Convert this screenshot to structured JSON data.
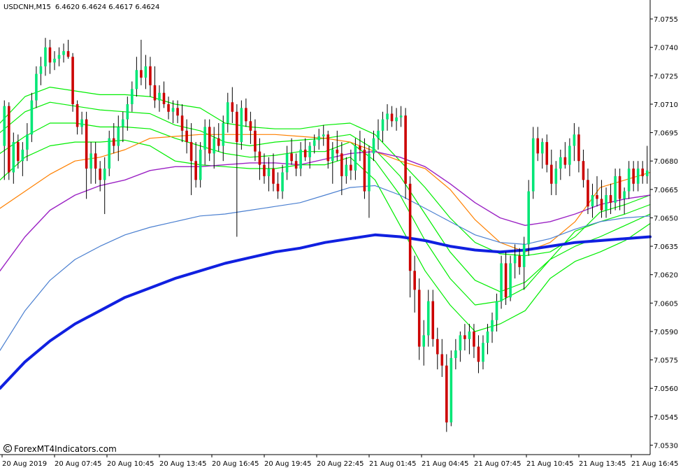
{
  "header": {
    "symbol_label": "USDCNH,M15",
    "ohlc_text": "6.4620 6.4624 6.4617 6.4624"
  },
  "watermark": {
    "text": "ForexMT4Indicators.com"
  },
  "chart_data": {
    "type": "candlestick",
    "y_axis_ticks": [
      "7.0755",
      "7.0740",
      "7.0725",
      "7.0710",
      "7.0695",
      "7.0680",
      "7.0665",
      "7.0650",
      "7.0635",
      "7.0620",
      "7.0605",
      "7.0590",
      "7.0575",
      "7.0560",
      "7.0545",
      "7.0530"
    ],
    "y_range": [
      7.0525,
      7.0765
    ],
    "x_axis_ticks": [
      "20 Aug 2019",
      "20 Aug 07:45",
      "20 Aug 10:45",
      "20 Aug 13:45",
      "20 Aug 16:45",
      "20 Aug 19:45",
      "20 Aug 22:45",
      "21 Aug 01:45",
      "21 Aug 04:45",
      "21 Aug 07:45",
      "21 Aug 10:45",
      "21 Aug 13:45",
      "21 Aug 16:45"
    ],
    "colors": {
      "background": "#ffffff",
      "axis": "#000000",
      "bull_candle": "#00e676",
      "bear_candle": "#cc0000",
      "wick": "#000000"
    },
    "candles": [
      {
        "o": 7.0688,
        "h": 7.0712,
        "l": 7.067,
        "c": 7.0709
      },
      {
        "o": 7.0709,
        "h": 7.0711,
        "l": 7.067,
        "c": 7.0674
      },
      {
        "o": 7.0674,
        "h": 7.0695,
        "l": 7.0668,
        "c": 7.069
      },
      {
        "o": 7.069,
        "h": 7.0694,
        "l": 7.0676,
        "c": 7.068
      },
      {
        "o": 7.068,
        "h": 7.069,
        "l": 7.0672,
        "c": 7.0686
      },
      {
        "o": 7.0686,
        "h": 7.07,
        "l": 7.068,
        "c": 7.0694
      },
      {
        "o": 7.0694,
        "h": 7.0716,
        "l": 7.069,
        "c": 7.0712
      },
      {
        "o": 7.0712,
        "h": 7.073,
        "l": 7.0708,
        "c": 7.0726
      },
      {
        "o": 7.0726,
        "h": 7.0735,
        "l": 7.072,
        "c": 7.073
      },
      {
        "o": 7.073,
        "h": 7.0745,
        "l": 7.0725,
        "c": 7.074
      },
      {
        "o": 7.074,
        "h": 7.0744,
        "l": 7.0726,
        "c": 7.0732
      },
      {
        "o": 7.0732,
        "h": 7.0738,
        "l": 7.0728,
        "c": 7.0734
      },
      {
        "o": 7.0734,
        "h": 7.074,
        "l": 7.073,
        "c": 7.0736
      },
      {
        "o": 7.0736,
        "h": 7.0742,
        "l": 7.0732,
        "c": 7.0738
      },
      {
        "o": 7.0738,
        "h": 7.0744,
        "l": 7.0734,
        "c": 7.0735
      },
      {
        "o": 7.0735,
        "h": 7.0737,
        "l": 7.0706,
        "c": 7.071
      },
      {
        "o": 7.071,
        "h": 7.0712,
        "l": 7.0694,
        "c": 7.0698
      },
      {
        "o": 7.0698,
        "h": 7.0706,
        "l": 7.0694,
        "c": 7.0702
      },
      {
        "o": 7.0702,
        "h": 7.0706,
        "l": 7.066,
        "c": 7.0676
      },
      {
        "o": 7.0676,
        "h": 7.069,
        "l": 7.0668,
        "c": 7.0684
      },
      {
        "o": 7.0684,
        "h": 7.069,
        "l": 7.0668,
        "c": 7.0676
      },
      {
        "o": 7.0676,
        "h": 7.068,
        "l": 7.0664,
        "c": 7.067
      },
      {
        "o": 7.067,
        "h": 7.0682,
        "l": 7.0652,
        "c": 7.0676
      },
      {
        "o": 7.0676,
        "h": 7.0696,
        "l": 7.0672,
        "c": 7.0692
      },
      {
        "o": 7.0692,
        "h": 7.07,
        "l": 7.0684,
        "c": 7.0688
      },
      {
        "o": 7.0688,
        "h": 7.0704,
        "l": 7.068,
        "c": 7.0698
      },
      {
        "o": 7.0698,
        "h": 7.0706,
        "l": 7.069,
        "c": 7.0702
      },
      {
        "o": 7.0702,
        "h": 7.0714,
        "l": 7.0696,
        "c": 7.071
      },
      {
        "o": 7.071,
        "h": 7.0722,
        "l": 7.0706,
        "c": 7.0718
      },
      {
        "o": 7.0718,
        "h": 7.0735,
        "l": 7.0714,
        "c": 7.0728
      },
      {
        "o": 7.0728,
        "h": 7.0744,
        "l": 7.072,
        "c": 7.0724
      },
      {
        "o": 7.0724,
        "h": 7.0736,
        "l": 7.0718,
        "c": 7.073
      },
      {
        "o": 7.073,
        "h": 7.0735,
        "l": 7.0714,
        "c": 7.072
      },
      {
        "o": 7.072,
        "h": 7.073,
        "l": 7.0708,
        "c": 7.0712
      },
      {
        "o": 7.0712,
        "h": 7.072,
        "l": 7.0706,
        "c": 7.0716
      },
      {
        "o": 7.0716,
        "h": 7.0722,
        "l": 7.0708,
        "c": 7.071
      },
      {
        "o": 7.071,
        "h": 7.0714,
        "l": 7.0702,
        "c": 7.0706
      },
      {
        "o": 7.0706,
        "h": 7.0712,
        "l": 7.07,
        "c": 7.0708
      },
      {
        "o": 7.0708,
        "h": 7.0712,
        "l": 7.07,
        "c": 7.0704
      },
      {
        "o": 7.0704,
        "h": 7.071,
        "l": 7.069,
        "c": 7.0696
      },
      {
        "o": 7.0696,
        "h": 7.0702,
        "l": 7.0684,
        "c": 7.069
      },
      {
        "o": 7.069,
        "h": 7.07,
        "l": 7.0662,
        "c": 7.068
      },
      {
        "o": 7.068,
        "h": 7.069,
        "l": 7.0666,
        "c": 7.067
      },
      {
        "o": 7.067,
        "h": 7.069,
        "l": 7.0666,
        "c": 7.0686
      },
      {
        "o": 7.0686,
        "h": 7.0702,
        "l": 7.0678,
        "c": 7.0698
      },
      {
        "o": 7.0698,
        "h": 7.0702,
        "l": 7.068,
        "c": 7.0684
      },
      {
        "o": 7.0684,
        "h": 7.0698,
        "l": 7.0676,
        "c": 7.0692
      },
      {
        "o": 7.0692,
        "h": 7.07,
        "l": 7.0685,
        "c": 7.0688
      },
      {
        "o": 7.0688,
        "h": 7.0704,
        "l": 7.068,
        "c": 7.07
      },
      {
        "o": 7.07,
        "h": 7.0716,
        "l": 7.0695,
        "c": 7.0711
      },
      {
        "o": 7.0711,
        "h": 7.0719,
        "l": 7.07,
        "c": 7.0706
      },
      {
        "o": 7.0706,
        "h": 7.071,
        "l": 7.064,
        "c": 7.069
      },
      {
        "o": 7.069,
        "h": 7.0712,
        "l": 7.0686,
        "c": 7.0708
      },
      {
        "o": 7.0708,
        "h": 7.0713,
        "l": 7.0698,
        "c": 7.0701
      },
      {
        "o": 7.0701,
        "h": 7.0706,
        "l": 7.0689,
        "c": 7.0696
      },
      {
        "o": 7.0696,
        "h": 7.0702,
        "l": 7.068,
        "c": 7.0685
      },
      {
        "o": 7.0685,
        "h": 7.0692,
        "l": 7.067,
        "c": 7.0678
      },
      {
        "o": 7.0678,
        "h": 7.0684,
        "l": 7.0668,
        "c": 7.0672
      },
      {
        "o": 7.0672,
        "h": 7.0682,
        "l": 7.0664,
        "c": 7.0676
      },
      {
        "o": 7.0676,
        "h": 7.0684,
        "l": 7.0664,
        "c": 7.0668
      },
      {
        "o": 7.0668,
        "h": 7.0674,
        "l": 7.066,
        "c": 7.0664
      },
      {
        "o": 7.0664,
        "h": 7.0678,
        "l": 7.066,
        "c": 7.0674
      },
      {
        "o": 7.0674,
        "h": 7.0688,
        "l": 7.067,
        "c": 7.0684
      },
      {
        "o": 7.0684,
        "h": 7.0692,
        "l": 7.0678,
        "c": 7.068
      },
      {
        "o": 7.068,
        "h": 7.0684,
        "l": 7.0672,
        "c": 7.0676
      },
      {
        "o": 7.0676,
        "h": 7.069,
        "l": 7.0672,
        "c": 7.0686
      },
      {
        "o": 7.0686,
        "h": 7.0692,
        "l": 7.068,
        "c": 7.0682
      },
      {
        "o": 7.0682,
        "h": 7.069,
        "l": 7.0676,
        "c": 7.0688
      },
      {
        "o": 7.0688,
        "h": 7.0694,
        "l": 7.0684,
        "c": 7.0691
      },
      {
        "o": 7.0691,
        "h": 7.0697,
        "l": 7.0686,
        "c": 7.0693
      },
      {
        "o": 7.0693,
        "h": 7.0699,
        "l": 7.0688,
        "c": 7.0694
      },
      {
        "o": 7.0694,
        "h": 7.0696,
        "l": 7.0676,
        "c": 7.068
      },
      {
        "o": 7.068,
        "h": 7.069,
        "l": 7.0668,
        "c": 7.0686
      },
      {
        "o": 7.0686,
        "h": 7.0696,
        "l": 7.068,
        "c": 7.0684
      },
      {
        "o": 7.0684,
        "h": 7.069,
        "l": 7.0662,
        "c": 7.0672
      },
      {
        "o": 7.0672,
        "h": 7.0682,
        "l": 7.0668,
        "c": 7.0678
      },
      {
        "o": 7.0678,
        "h": 7.0686,
        "l": 7.067,
        "c": 7.0675
      },
      {
        "o": 7.0675,
        "h": 7.0692,
        "l": 7.067,
        "c": 7.0688
      },
      {
        "o": 7.0688,
        "h": 7.0696,
        "l": 7.068,
        "c": 7.0686
      },
      {
        "o": 7.0686,
        "h": 7.0692,
        "l": 7.066,
        "c": 7.0664
      },
      {
        "o": 7.0664,
        "h": 7.0688,
        "l": 7.065,
        "c": 7.0684
      },
      {
        "o": 7.0684,
        "h": 7.0696,
        "l": 7.068,
        "c": 7.0692
      },
      {
        "o": 7.0692,
        "h": 7.0702,
        "l": 7.0686,
        "c": 7.0696
      },
      {
        "o": 7.0696,
        "h": 7.0706,
        "l": 7.069,
        "c": 7.0702
      },
      {
        "o": 7.0702,
        "h": 7.071,
        "l": 7.0696,
        "c": 7.0705
      },
      {
        "o": 7.0705,
        "h": 7.0709,
        "l": 7.0698,
        "c": 7.0701
      },
      {
        "o": 7.0701,
        "h": 7.0708,
        "l": 7.0696,
        "c": 7.0703
      },
      {
        "o": 7.0703,
        "h": 7.0709,
        "l": 7.0698,
        "c": 7.0704
      },
      {
        "o": 7.0704,
        "h": 7.0708,
        "l": 7.066,
        "c": 7.0668
      },
      {
        "o": 7.0668,
        "h": 7.0672,
        "l": 7.0608,
        "c": 7.0622
      },
      {
        "o": 7.0622,
        "h": 7.063,
        "l": 7.06,
        "c": 7.0612
      },
      {
        "o": 7.0612,
        "h": 7.0618,
        "l": 7.0575,
        "c": 7.0582
      },
      {
        "o": 7.0582,
        "h": 7.0596,
        "l": 7.0572,
        "c": 7.0588
      },
      {
        "o": 7.0588,
        "h": 7.0612,
        "l": 7.0582,
        "c": 7.0606
      },
      {
        "o": 7.0606,
        "h": 7.0612,
        "l": 7.0582,
        "c": 7.0586
      },
      {
        "o": 7.0586,
        "h": 7.0592,
        "l": 7.057,
        "c": 7.0578
      },
      {
        "o": 7.0578,
        "h": 7.0586,
        "l": 7.0566,
        "c": 7.0572
      },
      {
        "o": 7.0572,
        "h": 7.0578,
        "l": 7.0537,
        "c": 7.0542
      },
      {
        "o": 7.0542,
        "h": 7.058,
        "l": 7.054,
        "c": 7.0576
      },
      {
        "o": 7.0576,
        "h": 7.0586,
        "l": 7.057,
        "c": 7.058
      },
      {
        "o": 7.058,
        "h": 7.059,
        "l": 7.0574,
        "c": 7.0588
      },
      {
        "o": 7.0588,
        "h": 7.0594,
        "l": 7.058,
        "c": 7.0586
      },
      {
        "o": 7.0586,
        "h": 7.0594,
        "l": 7.0578,
        "c": 7.059
      },
      {
        "o": 7.059,
        "h": 7.0594,
        "l": 7.0576,
        "c": 7.0582
      },
      {
        "o": 7.0582,
        "h": 7.0588,
        "l": 7.0568,
        "c": 7.0574
      },
      {
        "o": 7.0574,
        "h": 7.0588,
        "l": 7.057,
        "c": 7.0584
      },
      {
        "o": 7.0584,
        "h": 7.0594,
        "l": 7.0578,
        "c": 7.059
      },
      {
        "o": 7.059,
        "h": 7.06,
        "l": 7.0584,
        "c": 7.0596
      },
      {
        "o": 7.0596,
        "h": 7.061,
        "l": 7.059,
        "c": 7.0606
      },
      {
        "o": 7.0606,
        "h": 7.063,
        "l": 7.0602,
        "c": 7.0626
      },
      {
        "o": 7.0626,
        "h": 7.0632,
        "l": 7.0604,
        "c": 7.0608
      },
      {
        "o": 7.0608,
        "h": 7.063,
        "l": 7.0606,
        "c": 7.0626
      },
      {
        "o": 7.0626,
        "h": 7.0636,
        "l": 7.0618,
        "c": 7.063
      },
      {
        "o": 7.063,
        "h": 7.0634,
        "l": 7.062,
        "c": 7.0624
      },
      {
        "o": 7.0624,
        "h": 7.064,
        "l": 7.0612,
        "c": 7.0636
      },
      {
        "o": 7.0636,
        "h": 7.067,
        "l": 7.063,
        "c": 7.0664
      },
      {
        "o": 7.0664,
        "h": 7.0698,
        "l": 7.066,
        "c": 7.0692
      },
      {
        "o": 7.0692,
        "h": 7.0698,
        "l": 7.068,
        "c": 7.0684
      },
      {
        "o": 7.0684,
        "h": 7.0692,
        "l": 7.0676,
        "c": 7.069
      },
      {
        "o": 7.069,
        "h": 7.0694,
        "l": 7.0674,
        "c": 7.0678
      },
      {
        "o": 7.0678,
        "h": 7.0686,
        "l": 7.0662,
        "c": 7.0668
      },
      {
        "o": 7.0668,
        "h": 7.068,
        "l": 7.0662,
        "c": 7.0676
      },
      {
        "o": 7.0676,
        "h": 7.0686,
        "l": 7.067,
        "c": 7.0682
      },
      {
        "o": 7.0682,
        "h": 7.069,
        "l": 7.0676,
        "c": 7.0678
      },
      {
        "o": 7.0678,
        "h": 7.0692,
        "l": 7.0672,
        "c": 7.0688
      },
      {
        "o": 7.0688,
        "h": 7.07,
        "l": 7.068,
        "c": 7.0694
      },
      {
        "o": 7.0694,
        "h": 7.0698,
        "l": 7.0674,
        "c": 7.068
      },
      {
        "o": 7.068,
        "h": 7.0686,
        "l": 7.0666,
        "c": 7.067
      },
      {
        "o": 7.067,
        "h": 7.0676,
        "l": 7.0652,
        "c": 7.0656
      },
      {
        "o": 7.0656,
        "h": 7.0668,
        "l": 7.065,
        "c": 7.0662
      },
      {
        "o": 7.0662,
        "h": 7.0672,
        "l": 7.0656,
        "c": 7.066
      },
      {
        "o": 7.066,
        "h": 7.067,
        "l": 7.065,
        "c": 7.0654
      },
      {
        "o": 7.0654,
        "h": 7.0666,
        "l": 7.065,
        "c": 7.0662
      },
      {
        "o": 7.0662,
        "h": 7.0668,
        "l": 7.0652,
        "c": 7.0658
      },
      {
        "o": 7.0658,
        "h": 7.0676,
        "l": 7.0654,
        "c": 7.0672
      },
      {
        "o": 7.0672,
        "h": 7.0676,
        "l": 7.0654,
        "c": 7.066
      },
      {
        "o": 7.066,
        "h": 7.0666,
        "l": 7.0652,
        "c": 7.0664
      },
      {
        "o": 7.0664,
        "h": 7.068,
        "l": 7.066,
        "c": 7.0676
      },
      {
        "o": 7.0676,
        "h": 7.068,
        "l": 7.0664,
        "c": 7.0668
      },
      {
        "o": 7.0668,
        "h": 7.068,
        "l": 7.0664,
        "c": 7.0676
      },
      {
        "o": 7.0676,
        "h": 7.068,
        "l": 7.0668,
        "c": 7.0672
      },
      {
        "o": 7.0672,
        "h": 7.0688,
        "l": 7.0668,
        "c": 7.0675
      }
    ],
    "ma_lines": [
      {
        "color": "#ff8000",
        "width": 1.2,
        "y": [
          7.0655,
          7.0664,
          7.0673,
          7.068,
          7.0682,
          7.0686,
          7.0692,
          7.0693,
          7.0694,
          7.0694,
          7.0694,
          7.0694,
          7.0693,
          7.0692,
          7.069,
          7.0685,
          7.068,
          7.0676,
          7.0665,
          7.0649,
          7.0637,
          7.0632,
          7.0637,
          7.0648,
          7.0666,
          7.067,
          7.0674
        ]
      },
      {
        "color": "#9b22c4",
        "width": 1.4,
        "y": [
          7.0622,
          7.064,
          7.0654,
          7.0662,
          7.0667,
          7.067,
          7.0675,
          7.0677,
          7.0677,
          7.0678,
          7.0679,
          7.0679,
          7.0678,
          7.0681,
          7.0684,
          7.0685,
          7.0682,
          7.0677,
          7.0668,
          7.0658,
          7.065,
          7.0646,
          7.0648,
          7.0652,
          7.0657,
          7.066,
          7.0662
        ]
      },
      {
        "color": "#4a7fd0",
        "width": 1.2,
        "y": [
          7.058,
          7.0601,
          7.0617,
          7.0628,
          7.0635,
          7.0641,
          7.0645,
          7.0648,
          7.0651,
          7.0652,
          7.0654,
          7.0656,
          7.0658,
          7.0662,
          7.0666,
          7.0667,
          7.0662,
          7.0655,
          7.0648,
          7.0641,
          7.0637,
          7.0636,
          7.0639,
          7.0644,
          7.0648,
          7.065,
          7.0651
        ]
      },
      {
        "color": "#1020e0",
        "width": 4,
        "y": [
          7.056,
          7.0574,
          7.0585,
          7.0594,
          7.0601,
          7.0608,
          7.0613,
          7.0618,
          7.0622,
          7.0626,
          7.0629,
          7.0632,
          7.0634,
          7.0637,
          7.0639,
          7.0641,
          7.064,
          7.0638,
          7.0635,
          7.0633,
          7.0632,
          7.0633,
          7.0635,
          7.0637,
          7.0638,
          7.0639,
          7.064
        ]
      }
    ],
    "bands": [
      {
        "color": "#00ee00",
        "width": 1.2,
        "y": [
          7.07,
          7.0714,
          7.0719,
          7.0717,
          7.0715,
          7.0715,
          7.0714,
          7.071,
          7.0708,
          7.07,
          7.0698,
          7.0697,
          7.0697,
          7.0699,
          7.07,
          7.0694,
          7.068,
          7.0666,
          7.065,
          7.0637,
          7.0631,
          7.063,
          7.0632,
          7.064,
          7.0653,
          7.0657,
          7.0662
        ]
      },
      {
        "color": "#00ee00",
        "width": 1.2,
        "y": [
          7.0695,
          7.0706,
          7.0711,
          7.0709,
          7.0707,
          7.0706,
          7.0705,
          7.0699,
          7.0696,
          7.069,
          7.0688,
          7.069,
          7.0691,
          7.0692,
          7.0694,
          7.0686,
          7.0672,
          7.0652,
          7.0632,
          7.0617,
          7.0611,
          7.0616,
          7.0628,
          7.0643,
          7.0648,
          7.0652,
          7.0657
        ]
      },
      {
        "color": "#00ee00",
        "width": 1.2,
        "y": [
          7.0684,
          7.0693,
          7.07,
          7.07,
          7.0698,
          7.0698,
          7.0697,
          7.0692,
          7.0688,
          7.0684,
          7.0682,
          7.0683,
          7.0685,
          7.0685,
          7.069,
          7.068,
          7.0662,
          7.0638,
          7.0618,
          7.0604,
          7.0606,
          7.0613,
          7.0628,
          7.0635,
          7.064,
          7.0646,
          7.0652
        ]
      },
      {
        "color": "#00ee00",
        "width": 1.2,
        "y": [
          7.067,
          7.0682,
          7.0688,
          7.069,
          7.069,
          7.0691,
          7.0688,
          7.068,
          7.0678,
          7.0677,
          7.0676,
          7.0676,
          7.0678,
          7.0678,
          7.0682,
          7.067,
          7.0646,
          7.0622,
          7.0604,
          7.059,
          7.0594,
          7.0601,
          7.0618,
          7.0627,
          7.0632,
          7.0638,
          7.0647
        ]
      }
    ]
  }
}
